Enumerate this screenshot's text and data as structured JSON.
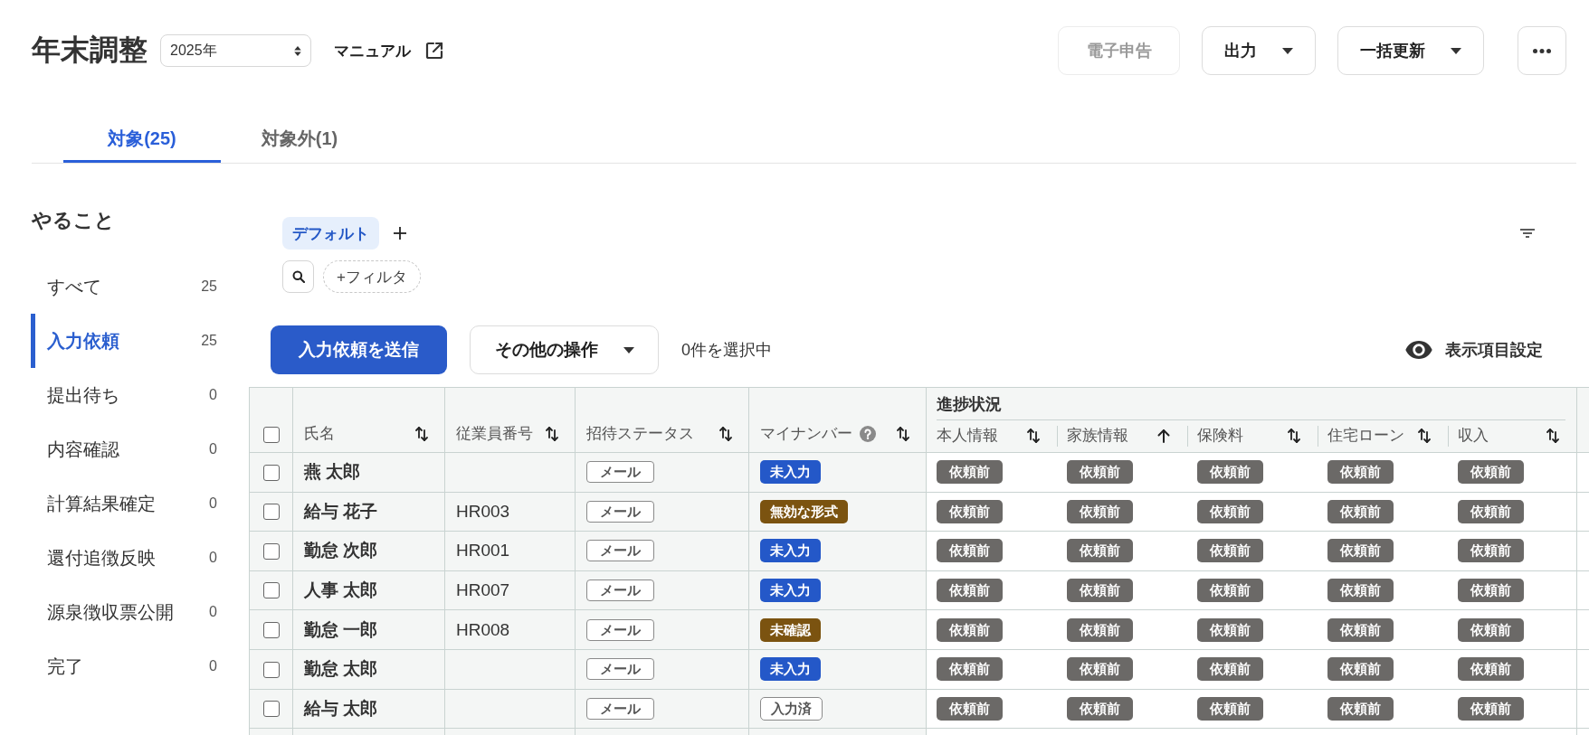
{
  "header": {
    "title": "年末調整",
    "year_select": {
      "value": "2025年"
    },
    "manual_link": {
      "label": "マニュアル"
    },
    "buttons": [
      {
        "label": "電子申告",
        "disabled": true,
        "kind": "plain"
      },
      {
        "label": "出力",
        "disabled": false,
        "kind": "dropdown"
      },
      {
        "label": "一括更新",
        "disabled": false,
        "kind": "dropdown"
      }
    ]
  },
  "tabs": [
    {
      "label": "対象(25)",
      "selected": true
    },
    {
      "label": "対象外(1)",
      "selected": false
    }
  ],
  "sidebar": {
    "title": "やること",
    "items": [
      {
        "label": "すべて",
        "count": "25",
        "selected": false
      },
      {
        "label": "入力依頼",
        "count": "25",
        "selected": true
      },
      {
        "label": "提出待ち",
        "count": "0",
        "selected": false
      },
      {
        "label": "内容確認",
        "count": "0",
        "selected": false
      },
      {
        "label": "計算結果確定",
        "count": "0",
        "selected": false
      },
      {
        "label": "還付追徴反映",
        "count": "0",
        "selected": false
      },
      {
        "label": "源泉徴収票公開",
        "count": "0",
        "selected": false
      },
      {
        "label": "完了",
        "count": "0",
        "selected": false
      }
    ]
  },
  "views": {
    "items": [
      {
        "label": "デフォルト",
        "selected": true
      }
    ]
  },
  "filter": {
    "add_label": "+フィルタ"
  },
  "actions": {
    "primary": "入力依頼を送信",
    "more": "その他の操作",
    "selection": "0件を選択中",
    "column_settings": "表示項目設定"
  },
  "table": {
    "select_all": {
      "checked": false
    },
    "columns": [
      {
        "label": "氏名",
        "sorted": false,
        "help": false
      },
      {
        "label": "従業員番号",
        "sorted": false,
        "help": false
      },
      {
        "label": "招待ステータス",
        "sorted": false,
        "help": false
      },
      {
        "label": "マイナンバー",
        "sorted": false,
        "help": true
      }
    ],
    "group": {
      "label": "進捗状況",
      "columns": [
        {
          "label": "本人情報",
          "sorted": false
        },
        {
          "label": "家族情報",
          "sorted": true
        },
        {
          "label": "保険料",
          "sorted": false
        },
        {
          "label": "住宅ローン",
          "sorted": false
        },
        {
          "label": "収入",
          "sorted": false
        }
      ]
    },
    "rows": [
      {
        "checked": false,
        "name": "燕 太郎",
        "invite": "メール",
        "my_number": {
          "label": "未入力",
          "kind": "missing"
        },
        "progress": [
          "依頼前",
          "依頼前",
          "依頼前",
          "依頼前",
          "依頼前"
        ]
      },
      {
        "checked": false,
        "name": "給与 花子",
        "employee_number": "HR003",
        "invite": "メール",
        "my_number": {
          "label": "無効な形式",
          "kind": "invalid"
        },
        "progress": [
          "依頼前",
          "依頼前",
          "依頼前",
          "依頼前",
          "依頼前"
        ]
      },
      {
        "checked": false,
        "name": "勤怠 次郎",
        "employee_number": "HR001",
        "invite": "メール",
        "my_number": {
          "label": "未入力",
          "kind": "missing"
        },
        "progress": [
          "依頼前",
          "依頼前",
          "依頼前",
          "依頼前",
          "依頼前"
        ]
      },
      {
        "checked": false,
        "name": "人事 太郎",
        "employee_number": "HR007",
        "invite": "メール",
        "my_number": {
          "label": "未入力",
          "kind": "missing"
        },
        "progress": [
          "依頼前",
          "依頼前",
          "依頼前",
          "依頼前",
          "依頼前"
        ]
      },
      {
        "checked": false,
        "name": "勤怠 一郎",
        "employee_number": "HR008",
        "invite": "メール",
        "my_number": {
          "label": "未確認",
          "kind": "unconfirmed"
        },
        "progress": [
          "依頼前",
          "依頼前",
          "依頼前",
          "依頼前",
          "依頼前"
        ]
      },
      {
        "checked": false,
        "name": "勤怠 太郎",
        "invite": "メール",
        "my_number": {
          "label": "未入力",
          "kind": "missing"
        },
        "progress": [
          "依頼前",
          "依頼前",
          "依頼前",
          "依頼前",
          "依頼前"
        ]
      },
      {
        "checked": false,
        "name": "給与 太郎",
        "invite": "メール",
        "my_number": {
          "label": "入力済",
          "kind": "entered"
        },
        "progress": [
          "依頼前",
          "依頼前",
          "依頼前",
          "依頼前",
          "依頼前"
        ]
      }
    ]
  }
}
